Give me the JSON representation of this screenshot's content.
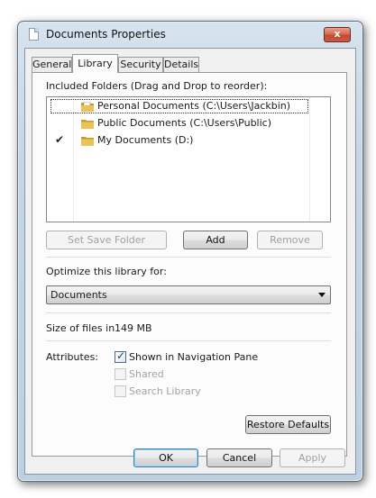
{
  "window": {
    "title": "Documents Properties",
    "close_glyph": "x"
  },
  "tabs": [
    {
      "label": "General",
      "active": false
    },
    {
      "label": "Library",
      "active": true
    },
    {
      "label": "Security",
      "active": false
    },
    {
      "label": "Details",
      "active": false
    }
  ],
  "library": {
    "included_label": "Included Folders (Drag and Drop to reorder):",
    "folders": [
      {
        "name": "Personal Documents (C:\\Users\\Jackbin)",
        "save_location": false,
        "icon": "folder-doc-icon"
      },
      {
        "name": "Public Documents (C:\\Users\\Public)",
        "save_location": false,
        "icon": "folder-icon"
      },
      {
        "name": "My Documents (D:)",
        "save_location": true,
        "icon": "folder-icon"
      }
    ],
    "checkmark": "✔",
    "set_save_folder_label": "Set Save Folder",
    "add_label": "Add",
    "remove_label": "Remove",
    "optimize_label": "Optimize this library for:",
    "optimize_value": "Documents",
    "size_label": "Size of files in",
    "size_value": "149 MB",
    "attributes_label": "Attributes:",
    "attributes": [
      {
        "label": "Shown in Navigation Pane",
        "checked": true,
        "enabled": true
      },
      {
        "label": "Shared",
        "checked": false,
        "enabled": false
      },
      {
        "label": "Search Library",
        "checked": false,
        "enabled": false
      }
    ],
    "restore_defaults_label": "Restore Defaults"
  },
  "footer": {
    "ok_label": "OK",
    "cancel_label": "Cancel",
    "apply_label": "Apply"
  },
  "colors": {
    "folder": "#e9c35a",
    "folder_dark": "#c89a2c",
    "accent": "#3c7fb1"
  }
}
